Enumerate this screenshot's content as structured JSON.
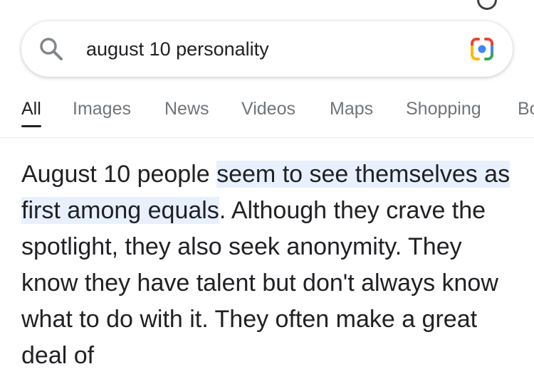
{
  "search": {
    "query": "august 10 personality"
  },
  "tabs": [
    {
      "label": "All",
      "active": true
    },
    {
      "label": "Images"
    },
    {
      "label": "News"
    },
    {
      "label": "Videos"
    },
    {
      "label": "Maps"
    },
    {
      "label": "Shopping"
    },
    {
      "label": "Bo"
    }
  ],
  "answer": {
    "intro": "August 10 people ",
    "highlight": "seem to see themselves as first among equals",
    "rest": ". Although they crave the spotlight, they also seek anonymity. They know they have talent but don't always know what to do with it. They often make a great deal of"
  },
  "colors": {
    "highlight_bg": "#e8f0fe",
    "text": "#202124",
    "tab_inactive": "#70757a"
  },
  "icons": {
    "search": "search-icon",
    "lens": "google-lens-icon"
  }
}
